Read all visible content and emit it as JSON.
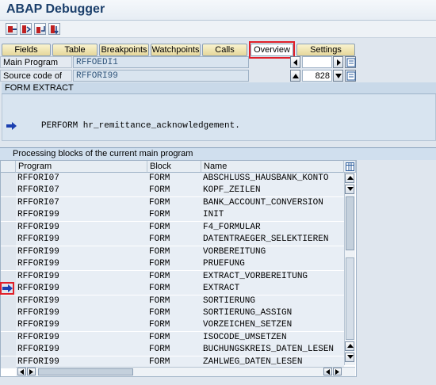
{
  "window": {
    "title": "ABAP Debugger"
  },
  "toolbar": {
    "icons": [
      "single-step-icon",
      "execute-icon",
      "return-icon",
      "continue-icon"
    ]
  },
  "tabs": [
    {
      "label": "Fields"
    },
    {
      "label": "Table"
    },
    {
      "label": "Breakpoints"
    },
    {
      "label": "Watchpoints"
    },
    {
      "label": "Calls"
    },
    {
      "label": "Overview",
      "active": true
    },
    {
      "label": "Settings"
    }
  ],
  "program": {
    "main_label": "Main Program",
    "main_value": "RFFOEDI1",
    "source_label": "Source code of",
    "source_value": "RFFORI99",
    "line_number": "828"
  },
  "form_extract": {
    "header": "FORM EXTRACT",
    "code": "PERFORM hr_remittance_acknowledgement."
  },
  "processing": {
    "header": "Processing blocks of the current main program",
    "columns": {
      "program": "Program",
      "block": "Block",
      "name": "Name"
    },
    "rows": [
      {
        "program": "RFFORI07",
        "block": "FORM",
        "name": "ABSCHLUSS_HAUSBANK_KONTO"
      },
      {
        "program": "RFFORI07",
        "block": "FORM",
        "name": "KOPF_ZEILEN"
      },
      {
        "program": "RFFORI07",
        "block": "FORM",
        "name": "BANK_ACCOUNT_CONVERSION"
      },
      {
        "program": "RFFORI99",
        "block": "FORM",
        "name": "INIT"
      },
      {
        "program": "RFFORI99",
        "block": "FORM",
        "name": "F4_FORMULAR"
      },
      {
        "program": "RFFORI99",
        "block": "FORM",
        "name": "DATENTRAEGER_SELEKTIEREN"
      },
      {
        "program": "RFFORI99",
        "block": "FORM",
        "name": "VORBEREITUNG"
      },
      {
        "program": "RFFORI99",
        "block": "FORM",
        "name": "PRUEFUNG"
      },
      {
        "program": "RFFORI99",
        "block": "FORM",
        "name": "EXTRACT_VORBEREITUNG"
      },
      {
        "program": "RFFORI99",
        "block": "FORM",
        "name": "EXTRACT",
        "current": true
      },
      {
        "program": "RFFORI99",
        "block": "FORM",
        "name": "SORTIERUNG"
      },
      {
        "program": "RFFORI99",
        "block": "FORM",
        "name": "SORTIERUNG_ASSIGN"
      },
      {
        "program": "RFFORI99",
        "block": "FORM",
        "name": "VORZEICHEN_SETZEN"
      },
      {
        "program": "RFFORI99",
        "block": "FORM",
        "name": "ISOCODE_UMSETZEN"
      },
      {
        "program": "RFFORI99",
        "block": "FORM",
        "name": "BUCHUNGSKREIS_DATEN_LESEN"
      },
      {
        "program": "RFFORI99",
        "block": "FORM",
        "name": "ZAHLWEG_DATEN_LESEN"
      }
    ]
  },
  "colors": {
    "title": "#1b3f6b",
    "tab": "#efe4b0",
    "highlight": "#e0202a",
    "arrow": "#1b3fb0"
  }
}
